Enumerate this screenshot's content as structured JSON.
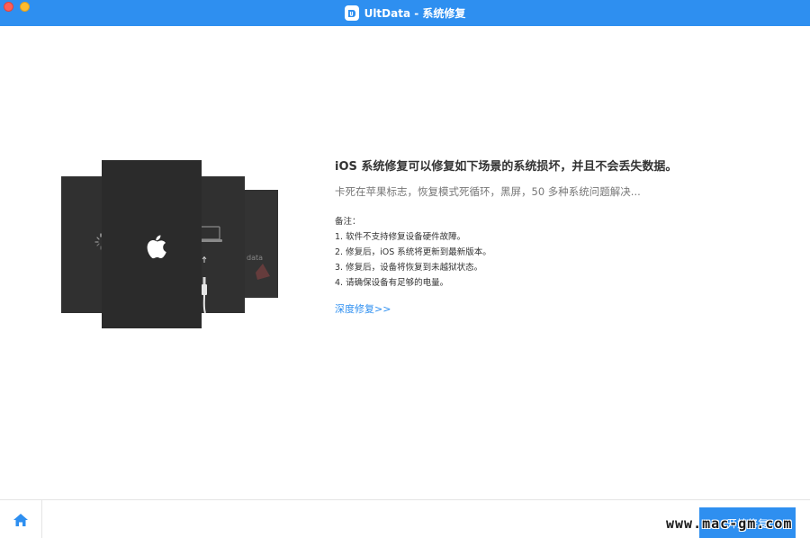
{
  "window": {
    "title": "UltData - 系统修复",
    "accent_color": "#2e8ff0",
    "icons": [
      "app-logo-icon",
      "home-icon"
    ]
  },
  "illustration": {
    "data_label": "data",
    "icons": [
      "loading-spinner-icon",
      "apple-logo-icon",
      "laptop-icon",
      "up-arrow-icon",
      "lightning-cable-icon",
      "warning-icon"
    ]
  },
  "main": {
    "headline": "iOS 系统修复可以修复如下场景的系统损坏，并且不会丢失数据。",
    "subline": "卡死在苹果标志，恢复模式死循环，黑屏，50 多种系统问题解决...",
    "notes_title": "备注：",
    "notes": [
      "1. 软件不支持修复设备硬件故障。",
      "2. 修复后，iOS 系统将更新到最新版本。",
      "3. 修复后，设备将恢复到未越狱状态。",
      "4. 请确保设备有足够的电量。"
    ],
    "deep_repair_link": "深度修复>>"
  },
  "footer": {
    "start_button": "开始修复",
    "watermark": "www.mac-gm.com"
  }
}
